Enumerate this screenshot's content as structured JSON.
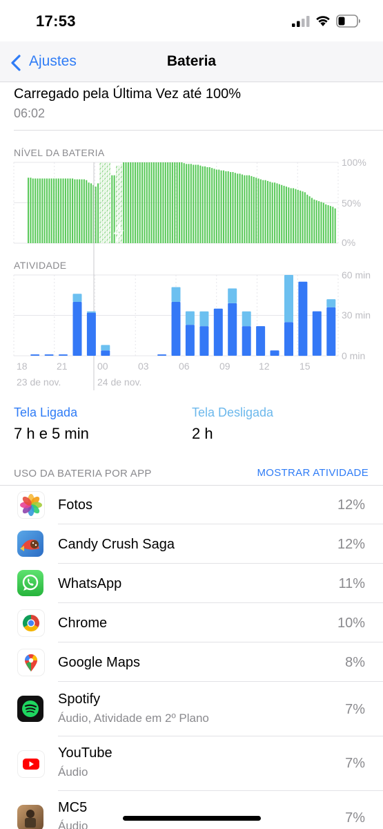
{
  "status_bar": {
    "time": "17:53"
  },
  "nav": {
    "back_label": "Ajustes",
    "title": "Bateria"
  },
  "last_charge": {
    "text": "Carregado pela Última Vez até 100%",
    "time": "06:02"
  },
  "battery_level": {
    "section_label": "NÍVEL DA BATERIA",
    "y_ticks": [
      "100%",
      "50%",
      "0%"
    ]
  },
  "activity": {
    "section_label": "ATIVIDADE",
    "y_ticks": [
      "60 min",
      "30 min",
      "0 min"
    ]
  },
  "x_ticks": [
    "18",
    "21",
    "00",
    "03",
    "06",
    "09",
    "12",
    "15"
  ],
  "date_labels": [
    "23 de nov.",
    "24 de nov."
  ],
  "chart_data": [
    {
      "type": "bar",
      "title": "NÍVEL DA BATERIA",
      "ylabel": "",
      "ylim": [
        0,
        100
      ],
      "y_ticks": [
        "100%",
        "50%",
        "0%"
      ],
      "x_ticks": [
        "18",
        "21",
        "00",
        "03",
        "06",
        "09",
        "12",
        "15"
      ],
      "series": [
        {
          "values": [
            81,
            81,
            80,
            80,
            80,
            80,
            80,
            80,
            80,
            80,
            80,
            80,
            80,
            80,
            80,
            80,
            80,
            80,
            80,
            80,
            79,
            79,
            79,
            79,
            79,
            78,
            75,
            74,
            72,
            70,
            74,
            100,
            100,
            100,
            100,
            100,
            84,
            84,
            96,
            96,
            98,
            100,
            100,
            100,
            100,
            100,
            100,
            100,
            100,
            100,
            100,
            100,
            100,
            100,
            100,
            100,
            100,
            100,
            100,
            100,
            100,
            100,
            100,
            100,
            100,
            100,
            100,
            99,
            98,
            98,
            98,
            97,
            97,
            97,
            96,
            95,
            95,
            94,
            94,
            93,
            92,
            91,
            91,
            90,
            90,
            89,
            89,
            88,
            88,
            87,
            86,
            86,
            85,
            84,
            84,
            84,
            83,
            82,
            81,
            80,
            79,
            78,
            78,
            77,
            76,
            75,
            75,
            74,
            73,
            72,
            71,
            70,
            69,
            68,
            68,
            67,
            66,
            65,
            64,
            63,
            60,
            58,
            56,
            54,
            53,
            52,
            51,
            50,
            48,
            47,
            46,
            45,
            43
          ]
        }
      ]
    },
    {
      "type": "bar",
      "title": "ATIVIDADE",
      "ylabel": "",
      "ylim": [
        0,
        60
      ],
      "y_ticks": [
        "60 min",
        "30 min",
        "0 min"
      ],
      "colors": {
        "screen_on": "#3478f6",
        "screen_off": "#6cc0f0"
      },
      "series": [
        {
          "name": "Tela Ligada",
          "values": [
            0,
            1,
            1,
            1,
            40,
            32,
            4,
            0,
            0,
            0,
            1,
            40,
            23,
            22,
            35,
            39,
            22,
            22,
            4,
            25,
            55,
            33,
            36
          ]
        },
        {
          "name": "Tela Desligada",
          "values": [
            0,
            0,
            0,
            0,
            6,
            1,
            4,
            0,
            0,
            0,
            0,
            11,
            10,
            11,
            0,
            11,
            11,
            0,
            0,
            35,
            0,
            0,
            6
          ]
        }
      ]
    }
  ],
  "summary": {
    "screen_on_label": "Tela Ligada",
    "screen_on_value": "7 h e 5 min",
    "screen_off_label": "Tela Desligada",
    "screen_off_value": "2 h"
  },
  "usage": {
    "section_label": "USO DA BATERIA POR APP",
    "show_activity": "MOSTRAR ATIVIDADE"
  },
  "apps": [
    {
      "name": "Fotos",
      "sub": "",
      "pct": "12%",
      "icon": "photos-icon"
    },
    {
      "name": "Candy Crush Saga",
      "sub": "",
      "pct": "12%",
      "icon": "candy-crush-icon"
    },
    {
      "name": "WhatsApp",
      "sub": "",
      "pct": "11%",
      "icon": "whatsapp-icon"
    },
    {
      "name": "Chrome",
      "sub": "",
      "pct": "10%",
      "icon": "chrome-icon"
    },
    {
      "name": "Google Maps",
      "sub": "",
      "pct": "8%",
      "icon": "google-maps-icon"
    },
    {
      "name": "Spotify",
      "sub": "Áudio, Atividade em 2º Plano",
      "pct": "7%",
      "icon": "spotify-icon"
    },
    {
      "name": "YouTube",
      "sub": "Áudio",
      "pct": "7%",
      "icon": "youtube-icon"
    },
    {
      "name": "MC5",
      "sub": "Áudio",
      "pct": "7%",
      "icon": "mc5-icon"
    }
  ]
}
